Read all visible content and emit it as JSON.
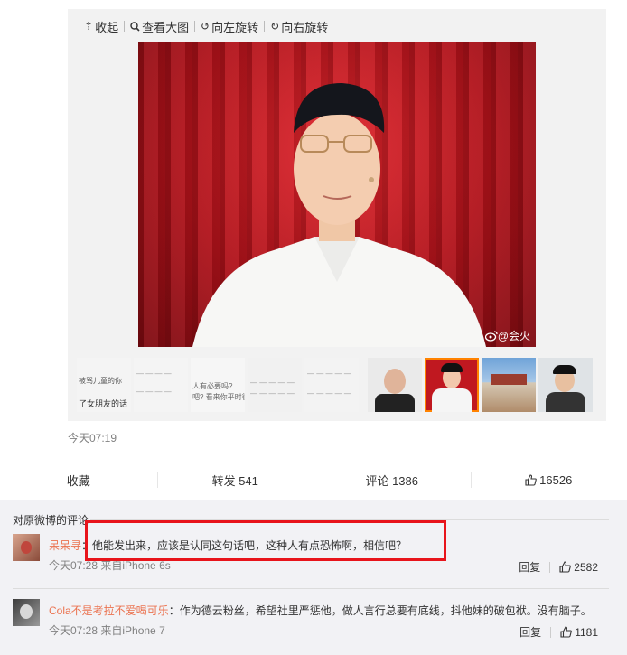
{
  "toolbar": {
    "collapse": "收起",
    "view_large": "查看大图",
    "rotate_left": "向左旋转",
    "rotate_right": "向右旋转"
  },
  "image": {
    "watermark": "@会火"
  },
  "thumbnails": [
    {
      "line1": "被骂儿童的你",
      "line2": "了女朋友的话"
    },
    {
      "line1": "",
      "line2": ""
    },
    {
      "line1": "人有必要吗?",
      "line2": "吧? 看来你平时很"
    },
    {
      "line1": "",
      "line2": ""
    },
    {
      "line1": "",
      "line2": ""
    },
    {
      "line1": "",
      "line2": ""
    },
    {
      "line1": "",
      "line2": ""
    },
    {
      "line1": "",
      "line2": ""
    },
    {
      "line1": "",
      "line2": ""
    }
  ],
  "post": {
    "time": "今天07:19"
  },
  "actions": {
    "favorite": "收藏",
    "repost": "转发 541",
    "comment": "评论 1386",
    "likes": "16526"
  },
  "comments_section": {
    "title": "对原微博的评论",
    "reply_label": "回复",
    "items": [
      {
        "user": "呆呆寻",
        "text": "：他能发出来，应该是认同这句话吧，这种人有点恐怖啊，相信吧？",
        "meta": "今天07:28 来自iPhone 6s",
        "likes": "2582"
      },
      {
        "user": "Cola不是考拉不爱喝可乐",
        "text": "：作为德云粉丝，希望社里严惩他，做人言行总要有底线，抖他妹的破包袱。没有脑子。",
        "meta": "今天07:28 来自iPhone 7",
        "likes": "1181"
      }
    ]
  },
  "colors": {
    "accent": "#eb7350",
    "highlight_border": "#e8141b",
    "selected_thumb": "#ff8200"
  }
}
